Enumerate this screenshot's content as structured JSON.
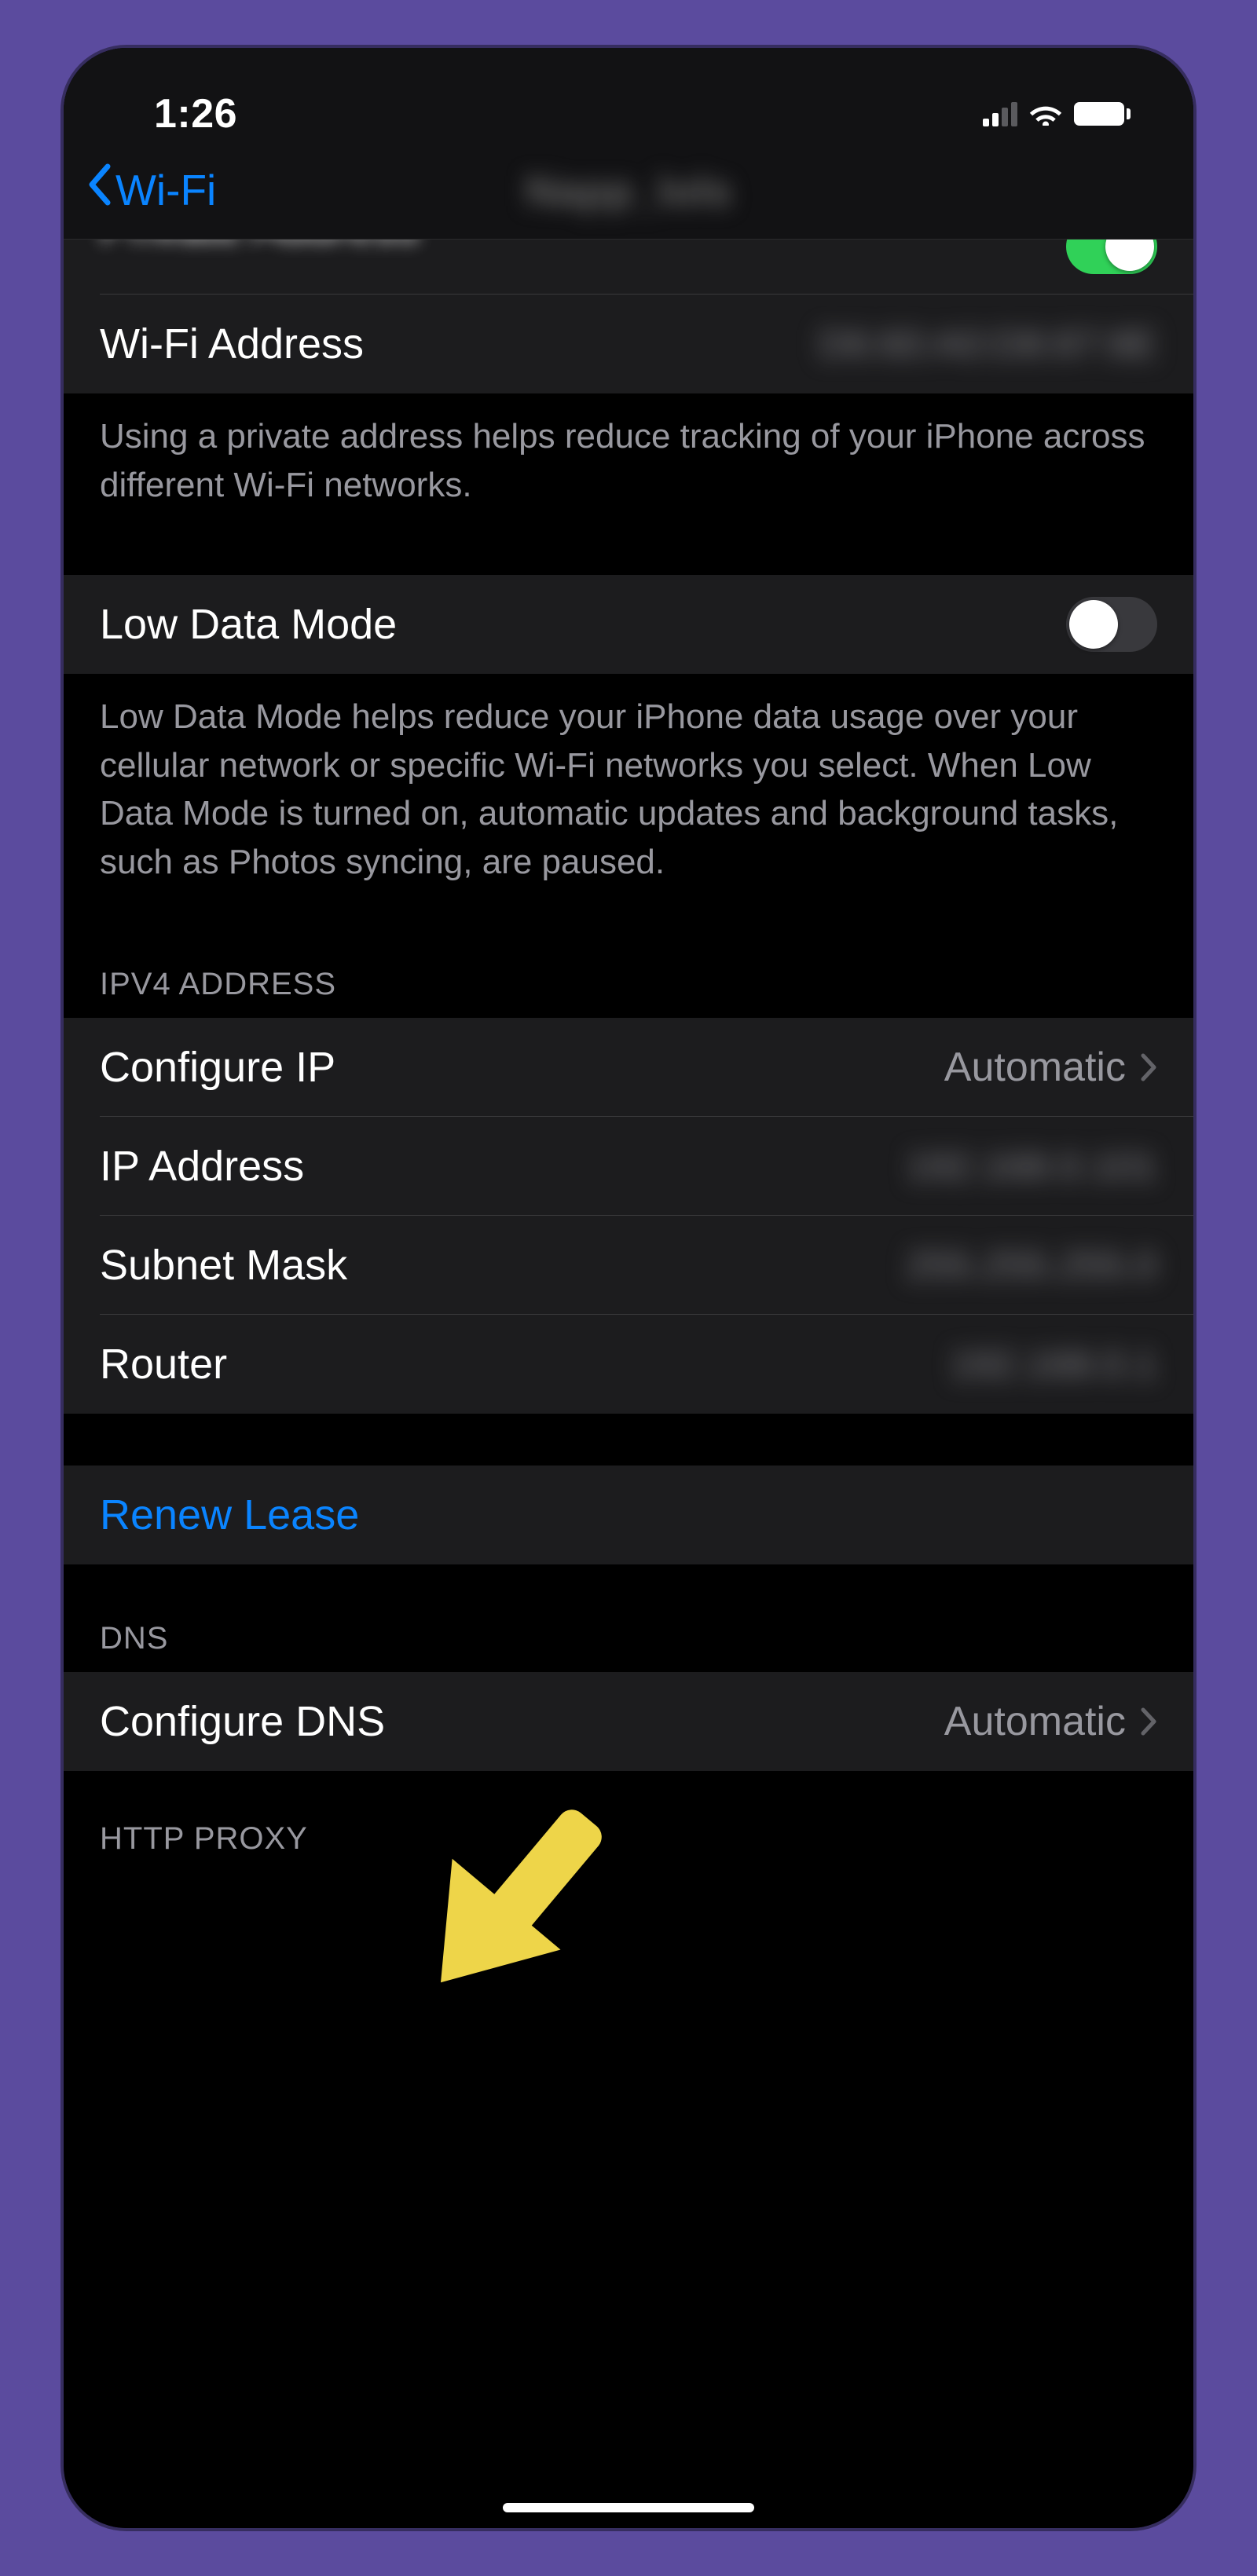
{
  "statusbar": {
    "time": "1:26"
  },
  "nav": {
    "back_label": "Wi-Fi",
    "title_blurred": "Napp_lols"
  },
  "rows": {
    "private_address_label_cut": "Private Address",
    "wifi_address": {
      "label": "Wi‑Fi Address",
      "value_blurred": "D6:60:A0:D8:87:8E"
    },
    "private_footer": "Using a private address helps reduce tracking of your iPhone across different Wi‑Fi networks.",
    "low_data": {
      "label": "Low Data Mode",
      "on": false
    },
    "low_data_footer": "Low Data Mode helps reduce your iPhone data usage over your cellular network or specific Wi‑Fi networks you select. When Low Data Mode is turned on, automatic updates and background tasks, such as Photos syncing, are paused.",
    "ipv4_header": "IPV4 ADDRESS",
    "configure_ip": {
      "label": "Configure IP",
      "value": "Automatic"
    },
    "ip_address": {
      "label": "IP Address",
      "value_blurred": "192.168.0.101"
    },
    "subnet_mask": {
      "label": "Subnet Mask",
      "value_blurred": "255.255.255.0"
    },
    "router": {
      "label": "Router",
      "value_blurred": "192.168.0.1"
    },
    "renew_lease": {
      "label": "Renew Lease"
    },
    "dns_header": "DNS",
    "configure_dns": {
      "label": "Configure DNS",
      "value": "Automatic"
    },
    "proxy_header": "HTTP PROXY"
  },
  "annotation": {
    "arrow_color": "#eed549"
  }
}
